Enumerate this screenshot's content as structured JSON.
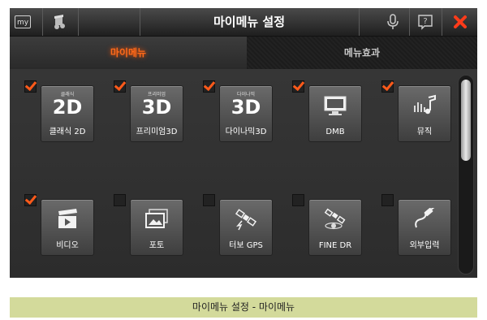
{
  "window": {
    "title": "마이메뉴 설정",
    "my_label": "my"
  },
  "tabs": [
    {
      "label": "마이메뉴",
      "active": true
    },
    {
      "label": "메뉴효과",
      "active": false
    }
  ],
  "menu_items": [
    {
      "name": "classic2d",
      "small": "클래식",
      "big": "2D",
      "label": "클래식 2D",
      "checked": true
    },
    {
      "name": "premium3d",
      "small": "프리미엄",
      "big": "3D",
      "label": "프리미엄3D",
      "checked": true
    },
    {
      "name": "dynamic3d",
      "small": "다이나믹",
      "big": "3D",
      "label": "다이나믹3D",
      "checked": true
    },
    {
      "name": "dmb",
      "label": "DMB",
      "icon": "monitor-icon",
      "checked": true
    },
    {
      "name": "music",
      "label": "뮤직",
      "icon": "music-icon",
      "checked": true
    },
    {
      "name": "video",
      "label": "비디오",
      "icon": "clapperboard-icon",
      "checked": true
    },
    {
      "name": "photo",
      "label": "포토",
      "icon": "photo-icon",
      "checked": false
    },
    {
      "name": "turbogps",
      "label": "터보 GPS",
      "icon": "satellite-icon",
      "checked": false
    },
    {
      "name": "finedr",
      "label": "FINE DR",
      "icon": "satellite-orbit-icon",
      "checked": false
    },
    {
      "name": "external",
      "label": "외부입력",
      "icon": "cable-icon",
      "checked": false
    }
  ],
  "caption": "마이메뉴 설정 - 마이메뉴",
  "colors": {
    "accent": "#ff5a1a",
    "caption_bg": "#d3da9b",
    "close": "#ff3b1a"
  }
}
